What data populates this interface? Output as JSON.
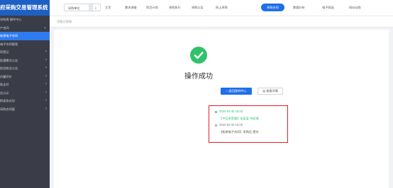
{
  "app": {
    "title": "府采购交易管理系统"
  },
  "sidebar": {
    "items": [
      {
        "label": "采购周 操作中心",
        "has_chevron": false
      },
      {
        "label": "产合同",
        "has_chevron": true
      },
      {
        "label": "新建电子合同",
        "has_chevron": false,
        "active": true
      },
      {
        "label": "电子合同管理",
        "has_chevron": false
      },
      {
        "label": "同登记",
        "has_chevron": true
      },
      {
        "label": "批量整及公告",
        "has_chevron": true
      },
      {
        "label": "批验收及公告",
        "has_chevron": true
      },
      {
        "label": "约履评价",
        "has_chevron": true
      },
      {
        "label": "款支付",
        "has_chevron": true
      },
      {
        "label": "告公示",
        "has_chevron": true
      },
      {
        "label": "框架协议包",
        "has_chevron": true
      },
      {
        "label": "采购合同管",
        "has_chevron": true
      }
    ]
  },
  "topbar": {
    "unit_select": "采购单位",
    "nav": [
      {
        "label": "主页"
      },
      {
        "label": "需求调查"
      },
      {
        "label": "项目计划"
      },
      {
        "label": "采购执行"
      },
      {
        "label": "采购公告"
      },
      {
        "label": "网上采购"
      },
      {
        "label": "采购合同",
        "active": true
      },
      {
        "label": "数据分析"
      },
      {
        "label": "电子保函"
      },
      {
        "label": "网站动态"
      }
    ]
  },
  "breadcrumb": {
    "text": "可签订合同"
  },
  "result": {
    "title": "操作成功",
    "back_button": "返回我的中心",
    "view_button": "查看详情"
  },
  "log": [
    {
      "time": "2024-04-30 15:00",
      "desc": "【中征采签量】张某某 待处理",
      "status": "done"
    },
    {
      "time": "2024-04-30 15:00",
      "desc": "【新建电子合同】采购员 提交",
      "status": "pending"
    }
  ],
  "colors": {
    "accent": "#1e6fe8",
    "success": "#31c26a",
    "sidebar": "#3a3d47",
    "highlight_border": "#e02020"
  }
}
